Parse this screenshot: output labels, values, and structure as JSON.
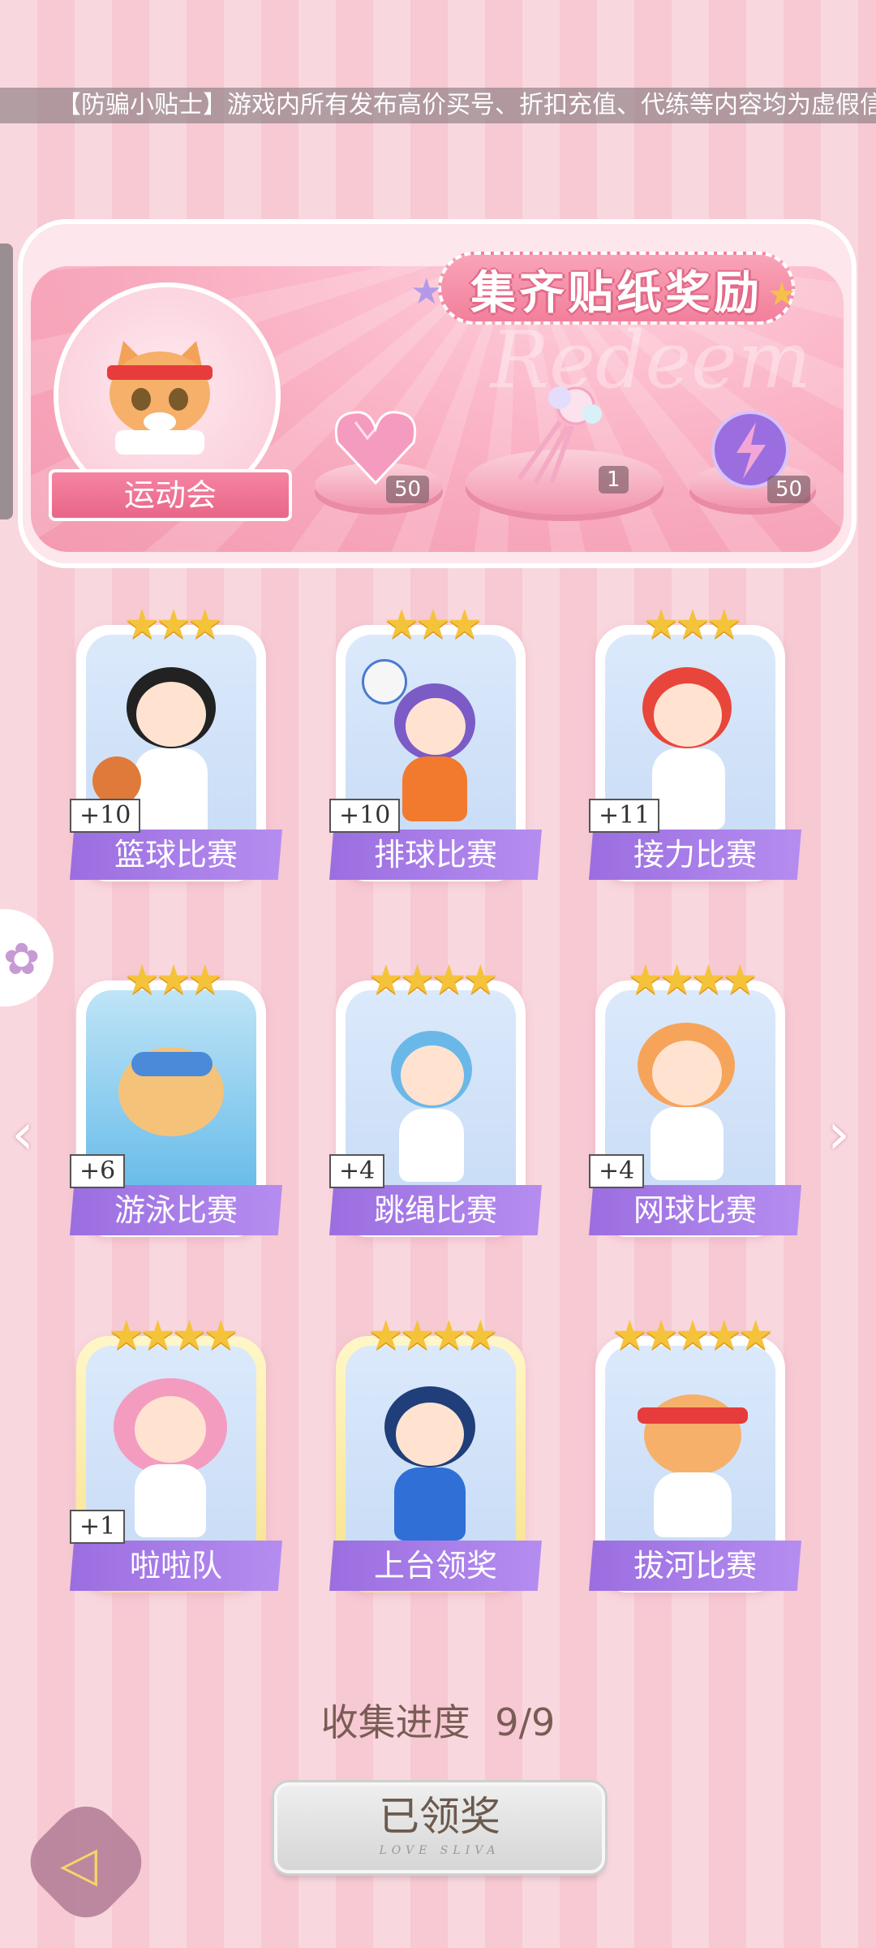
{
  "ticker": "【防骗小贴士】游戏内所有发布高价买号、折扣充值、代练等内容均为虚假信",
  "banner": {
    "title": "集齐贴纸奖励",
    "watermark": "Redeem",
    "event_name": "运动会",
    "rewards": [
      {
        "icon": "heart-gem-icon",
        "qty": "50"
      },
      {
        "icon": "bouquet-icon",
        "qty": "1"
      },
      {
        "icon": "energy-orb-icon",
        "qty": "50"
      }
    ]
  },
  "cards": [
    {
      "label": "篮球比赛",
      "stars": "★★★",
      "bonus": "+10"
    },
    {
      "label": "排球比赛",
      "stars": "★★★",
      "bonus": "+10"
    },
    {
      "label": "接力比赛",
      "stars": "★★★",
      "bonus": "+11"
    },
    {
      "label": "游泳比赛",
      "stars": "★★★",
      "bonus": "+6"
    },
    {
      "label": "跳绳比赛",
      "stars": "★★★★",
      "bonus": "+4"
    },
    {
      "label": "网球比赛",
      "stars": "★★★★",
      "bonus": "+4"
    },
    {
      "label": "啦啦队",
      "stars": "★★★★",
      "bonus": "+1"
    },
    {
      "label": "上台领奖",
      "stars": "★★★★",
      "bonus": ""
    },
    {
      "label": "拔河比赛",
      "stars": "★★★★★",
      "bonus": ""
    }
  ],
  "progress": {
    "label": "收集进度",
    "value": "9/9"
  },
  "claim_button": {
    "label": "已领奖",
    "sub": "LOVE SLIVA"
  },
  "colors": {
    "accent_purple": "#a67be8",
    "pink": "#f6a8bc",
    "star": "#f5c33a"
  }
}
